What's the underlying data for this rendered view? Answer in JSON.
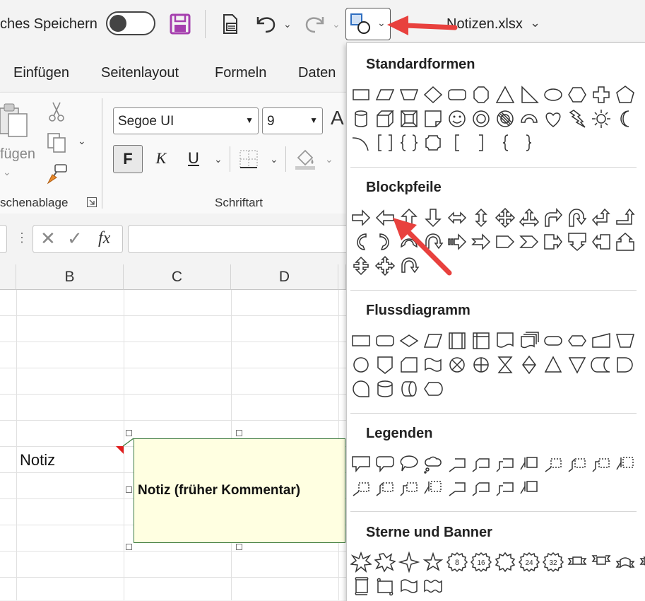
{
  "titlebar": {
    "autosave_label": "ches Speichern",
    "filename": "Notizen.xlsx"
  },
  "tabs": [
    "Einfügen",
    "Seitenlayout",
    "Formeln",
    "Daten"
  ],
  "ribbon": {
    "paste_label": "fügen",
    "clipboard_group": "schenablage",
    "font_name": "Segoe UI",
    "font_size": "9",
    "bold": "F",
    "italic": "K",
    "underline": "U",
    "font_group": "Schriftart"
  },
  "formula_bar": {
    "fx": "fx"
  },
  "grid": {
    "columns": [
      "B",
      "C",
      "D"
    ],
    "cell_b": "Notiz"
  },
  "note": {
    "text": "Notiz (früher Kommentar)"
  },
  "gallery": {
    "sections": [
      {
        "title": "Standardformen"
      },
      {
        "title": "Blockpfeile"
      },
      {
        "title": "Flussdiagramm"
      },
      {
        "title": "Legenden"
      },
      {
        "title": "Sterne und Banner"
      }
    ],
    "star_labels": [
      "8",
      "16",
      "24",
      "32"
    ]
  },
  "colors": {
    "accent_arrow": "#e8413e",
    "note_bg": "#ffffe1",
    "note_border": "#3b7a3b",
    "save_icon": "#a53fae",
    "shapes_icon": "#2f6fc1"
  }
}
